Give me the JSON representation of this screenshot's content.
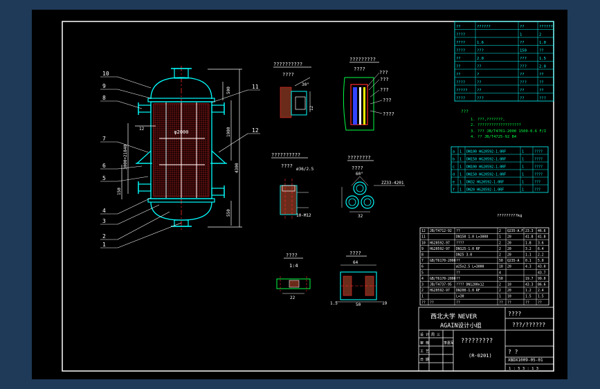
{
  "colors": {
    "frame": "#ffffff",
    "cyan": "#00ffff",
    "red": "#ff2a2a",
    "green": "#00ff44",
    "yellow": "#ffff00",
    "blue": "#3344ff",
    "grey": "#b5b5b5"
  },
  "labels": {
    "balloons": [
      "10",
      "9",
      "8",
      "7",
      "6",
      "5",
      "4",
      "3",
      "2",
      "1",
      "11",
      "12"
    ],
    "detail1_title": "??????????",
    "detail1_sub": "????",
    "detail2_title": "?????????",
    "detail2_sub": "????",
    "detail2_leaders": [
      "???",
      "???",
      "???",
      "???",
      "????"
    ],
    "detail3_title": "??????????",
    "detail3_sub": "????",
    "detail4_title": "????????",
    "detail4_sub": "????",
    "detail5_title": "????",
    "detail5_scale": "1:4",
    "detail6_title": "????",
    "dims": {
      "d1": "1980",
      "d2": "4300",
      "d3": "550",
      "d4": "500",
      "d5": "3000+21840",
      "d6": "60°",
      "d7": "32",
      "d8": "12",
      "d9": "10-M12",
      "d10": "ø36/2.5",
      "d11": "ZZ33-4201",
      "d12": "64",
      "d13": "12",
      "d14": "150",
      "d15": "1:5",
      "d16": "22",
      "d17": "50",
      "d18": "19"
    },
    "notes_title": "???",
    "notes": [
      "1. ???,???????,",
      "2. ???????????????????",
      "3. ???  JB/T4701-2000  1500-0.6 F/I",
      "4. ?? JB/T4725-92 B4"
    ],
    "mass": "?????????kg",
    "title_block": {
      "school": "西北大学",
      "group1": "NEVER",
      "group2": "AGAIN设计小组",
      "drawing_title": "?????????",
      "code": "(R-0201)",
      "right1": "????",
      "right2": "???/??????",
      "number": "XBDX1009-05-01",
      "mark": "? ?",
      "row1": "设 计",
      "row2": "审 核",
      "row3": "工 艺",
      "row4": "日 期",
      "name1": "周 三",
      "name2": "李嘉军",
      "scale_row": "1 : 5    3 : 1 3"
    }
  },
  "top_table": {
    "header": [
      "",
      "",
      "",
      ""
    ],
    "rows": [
      [
        "??",
        "??????",
        "??",
        "??????"
      ],
      [
        "????",
        "",
        "1",
        "2"
      ],
      [
        "????",
        "1.6",
        "??",
        "1.0"
      ],
      [
        "????",
        "???",
        "150",
        "??"
      ],
      [
        "??",
        "2.0",
        "???",
        "1.5"
      ],
      [
        "??",
        "??",
        "???",
        "2.0"
      ],
      [
        "??",
        "?",
        "??",
        "??"
      ],
      [
        "????",
        "??",
        "???",
        "??"
      ],
      [
        "?????",
        "??",
        "??",
        "??"
      ],
      [
        "????",
        "???",
        "??",
        "???"
      ]
    ]
  },
  "nozzle_table": {
    "rows": [
      [
        "a",
        "1",
        "DN100 HG20592-1.0RF",
        "1",
        "????"
      ],
      [
        "b",
        "1",
        "DN150 HG20592-1.0RF",
        "1",
        "????"
      ],
      [
        "c",
        "1",
        "DN100 HG20592-1.0RF",
        "1",
        "????"
      ],
      [
        "d",
        "1",
        "DN150 HG20592-1.0RF",
        "1",
        "????"
      ],
      [
        "e",
        "1",
        "DN32 HG20592-1.0RF",
        "1",
        "???"
      ],
      [
        "f",
        "1",
        "DN20 HG20592-1.0RF",
        "1",
        "???"
      ]
    ]
  },
  "parts_table": {
    "rows": [
      [
        "12",
        "JB/T4712-92",
        "??",
        "2",
        "Q235-A.F",
        "23.3",
        "46.6"
      ],
      [
        "11",
        "",
        "DN150 1.0 L=3000",
        "1",
        "20",
        "41.8",
        "41.8"
      ],
      [
        "10",
        "HG20592-97",
        "????",
        "2",
        "20",
        "1.8",
        "3.6"
      ],
      [
        "9",
        "HG20592-97",
        "DN125-1.0 RF",
        "2",
        "20",
        "3.2",
        "6.4"
      ],
      [
        "8",
        "",
        "DN25 3.0",
        "2",
        "20",
        "1.1",
        "2.2"
      ],
      [
        "7",
        "GB/T6170-2000",
        "??",
        "50",
        "Q235-A",
        "0.1",
        "5.0"
      ],
      [
        "6",
        "",
        "ø25x2.5 L=3000",
        "10",
        "20",
        "4.3",
        "43.0"
      ],
      [
        "5",
        "",
        "??",
        "4",
        "",
        "",
        "43.7"
      ],
      [
        "4",
        "GB/T6170-2000",
        "??",
        "50",
        "",
        "19.7",
        "99.0"
      ],
      [
        "3",
        "JB/T4737-95",
        "????   DN1200x12",
        "2",
        "10",
        "43.3",
        "86.6"
      ],
      [
        "2",
        "HG20592-97",
        "DN200-1.0 RF",
        "2",
        "20",
        "1.2",
        "2.4"
      ],
      [
        "1",
        "",
        "L=30",
        "1",
        "10",
        "1.5",
        "1.5"
      ],
      [
        "??",
        "??",
        "??",
        "??",
        "??",
        "??",
        "??"
      ]
    ]
  }
}
